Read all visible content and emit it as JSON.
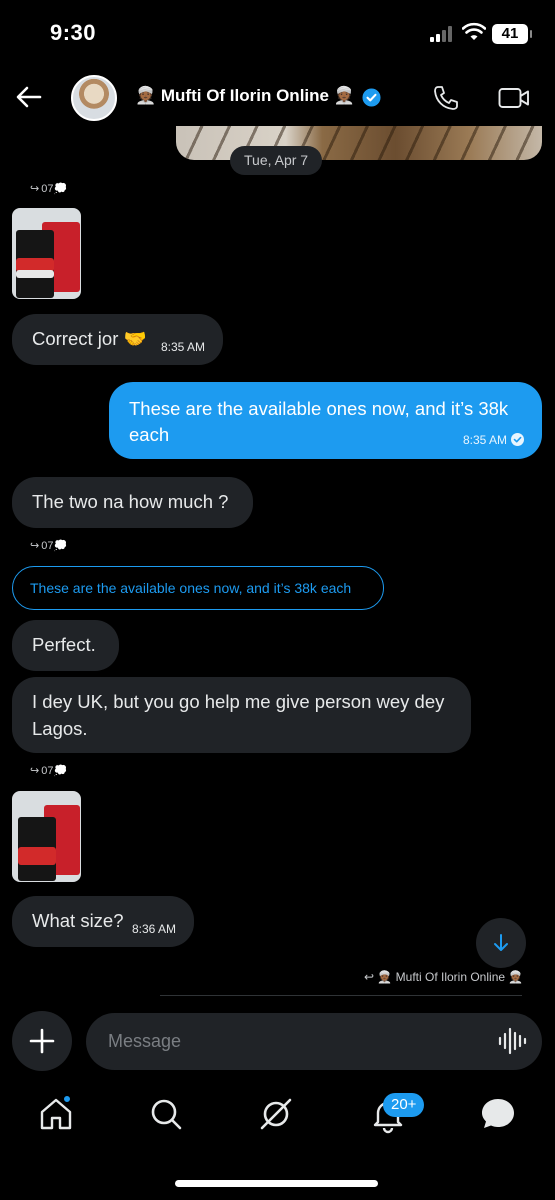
{
  "status_bar": {
    "time": "9:30",
    "battery": "41"
  },
  "header": {
    "title": "👳🏾 Mufti Of Ilorin Online 👳🏾"
  },
  "date_separator": "Tue, Apr 7",
  "reply_marker": "07💭",
  "messages": {
    "m1": {
      "text": "Correct jor 🤝",
      "time": "8:35 AM"
    },
    "m2": {
      "text_line1": "These are the available ones now, and it’s 38k",
      "text_line2": "each",
      "time": "8:35 AM"
    },
    "m3": {
      "text": "The two na how much ?"
    },
    "quoted": {
      "text": "These are the available ones now, and it’s 38k each"
    },
    "m4": {
      "text": "Perfect."
    },
    "m5": {
      "text_line1": "I dey UK, but you go help me give person wey dey",
      "text_line2": "Lagos."
    },
    "m6": {
      "text": "What size?",
      "time": "8:36 AM"
    }
  },
  "typing_reply": "👳🏾 Mufti Of Ilorin Online 👳🏾",
  "composer": {
    "placeholder": "Message"
  },
  "tabs": {
    "notifications_badge": "20+"
  },
  "colors": {
    "accent": "#1d9bf0",
    "bubble_in": "#202327",
    "background": "#000000"
  },
  "icons": [
    "back-arrow-icon",
    "verified-badge-icon",
    "phone-icon",
    "video-camera-icon",
    "plus-icon",
    "voice-wave-icon",
    "home-icon",
    "search-icon",
    "grok-icon",
    "bell-icon",
    "messages-icon",
    "arrow-down-icon"
  ]
}
